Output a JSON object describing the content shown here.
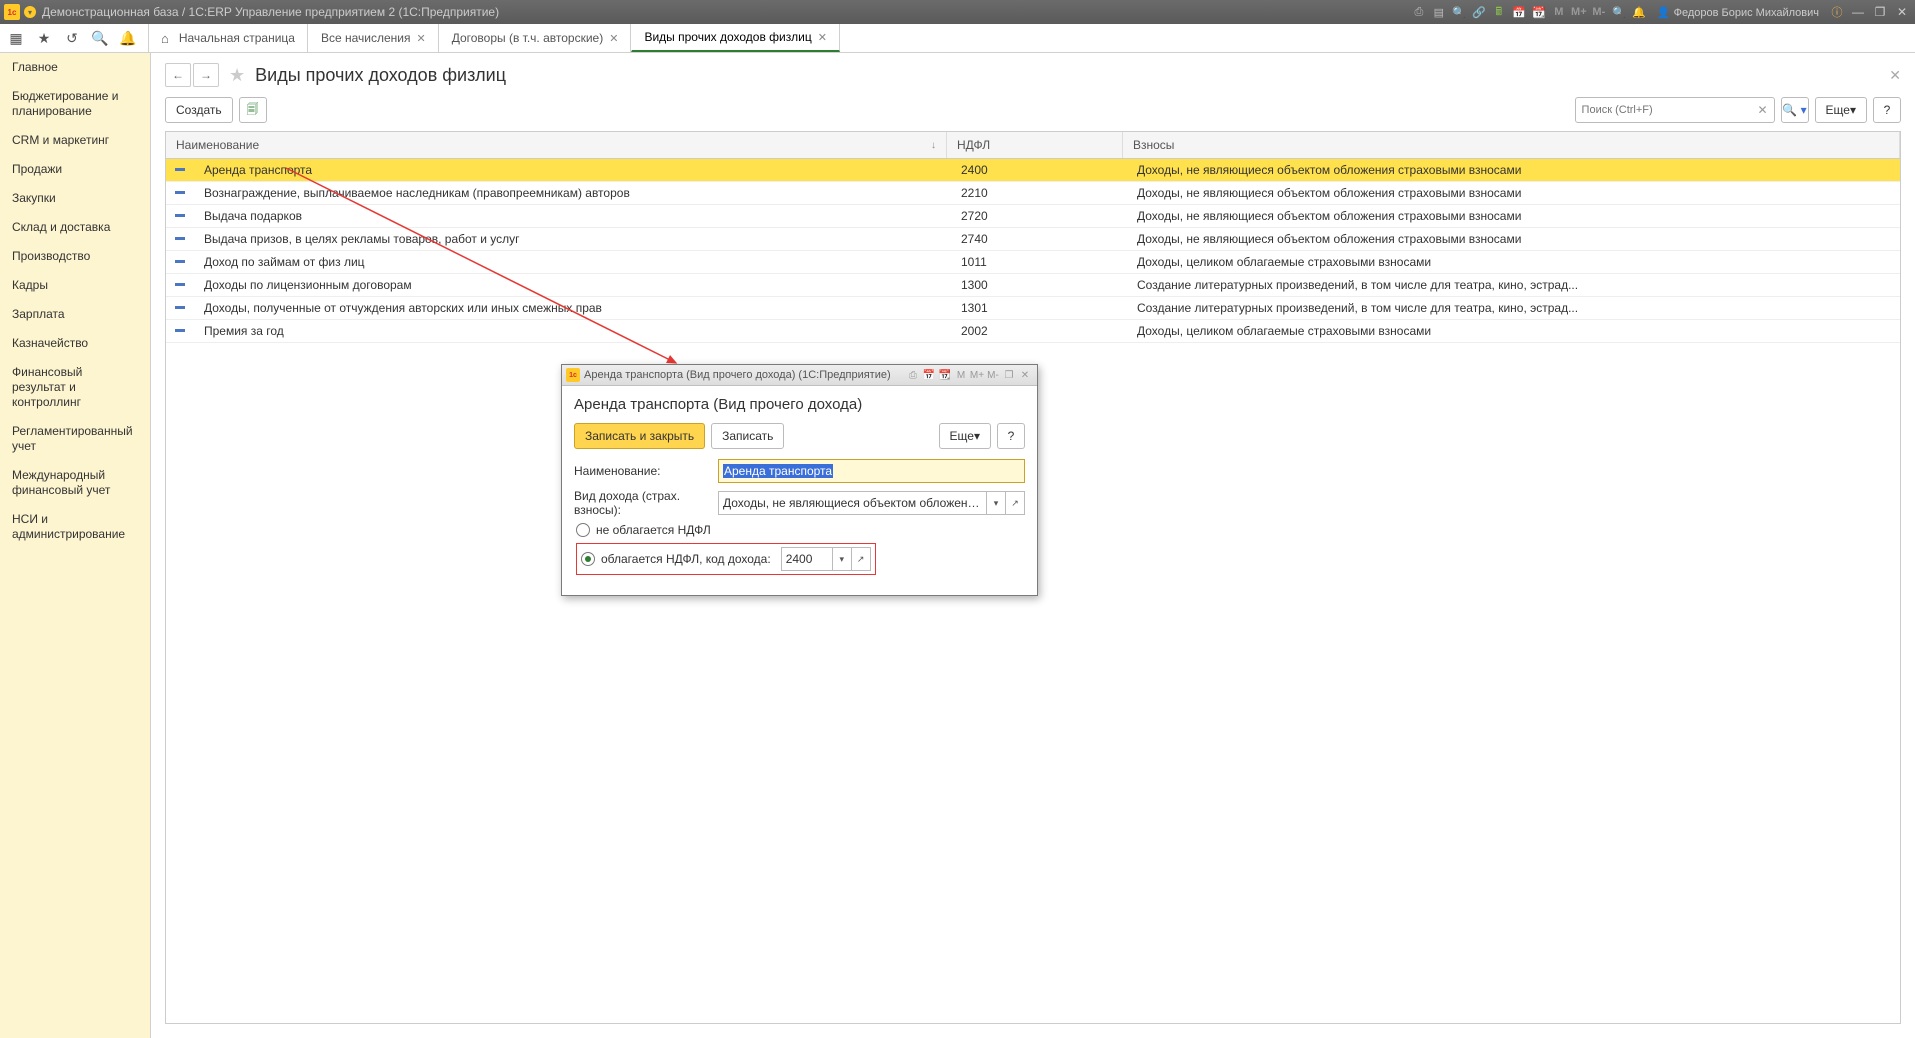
{
  "app": {
    "title": "Демонстрационная база / 1С:ERP Управление предприятием 2  (1С:Предприятие)",
    "user": "Федоров Борис Михайлович",
    "m_buttons": [
      "M",
      "M+",
      "M-"
    ]
  },
  "nav_tabs": {
    "home": "Начальная страница",
    "tabs": [
      {
        "label": "Все начисления"
      },
      {
        "label": "Договоры (в т.ч. авторские)"
      },
      {
        "label": "Виды прочих доходов физлиц",
        "active": true
      }
    ]
  },
  "sidebar": {
    "items": [
      "Главное",
      "Бюджетирование и планирование",
      "CRM и маркетинг",
      "Продажи",
      "Закупки",
      "Склад и доставка",
      "Производство",
      "Кадры",
      "Зарплата",
      "Казначейство",
      "Финансовый результат и контроллинг",
      "Регламентированный учет",
      "Международный финансовый учет",
      "НСИ и администрирование"
    ]
  },
  "page": {
    "title": "Виды прочих доходов физлиц",
    "create_label": "Создать",
    "search_placeholder": "Поиск (Ctrl+F)",
    "more_label": "Еще",
    "help_label": "?"
  },
  "table": {
    "columns": {
      "name": "Наименование",
      "ndfl": "НДФЛ",
      "vzn": "Взносы"
    },
    "rows": [
      {
        "name": "Аренда транспорта",
        "ndfl": "2400",
        "vzn": "Доходы, не являющиеся объектом обложения страховыми взносами",
        "selected": true
      },
      {
        "name": "Вознаграждение, выплачиваемое наследникам (правопреемникам) авторов",
        "ndfl": "2210",
        "vzn": "Доходы, не являющиеся объектом обложения страховыми взносами"
      },
      {
        "name": "Выдача подарков",
        "ndfl": "2720",
        "vzn": "Доходы, не являющиеся объектом обложения страховыми взносами"
      },
      {
        "name": "Выдача призов, в целях рекламы товаров, работ и услуг",
        "ndfl": "2740",
        "vzn": "Доходы, не являющиеся объектом обложения страховыми взносами"
      },
      {
        "name": "Доход по займам от физ лиц",
        "ndfl": "1011",
        "vzn": "Доходы, целиком облагаемые страховыми взносами"
      },
      {
        "name": "Доходы по лицензионным договорам",
        "ndfl": "1300",
        "vzn": "Создание литературных произведений, в том числе для театра, кино, эстрад..."
      },
      {
        "name": "Доходы, полученные от отчуждения авторских или иных смежных прав",
        "ndfl": "1301",
        "vzn": "Создание литературных произведений, в том числе для театра, кино, эстрад..."
      },
      {
        "name": "Премия за год",
        "ndfl": "2002",
        "vzn": "Доходы, целиком облагаемые страховыми взносами"
      }
    ]
  },
  "dialog": {
    "window_title": "Аренда транспорта (Вид прочего дохода)  (1С:Предприятие)",
    "heading": "Аренда транспорта (Вид прочего дохода)",
    "save_close": "Записать и закрыть",
    "save": "Записать",
    "more": "Еще",
    "help": "?",
    "m_buttons": [
      "M",
      "M+",
      "M-"
    ],
    "fields": {
      "name_label": "Наименование:",
      "name_value": "Аренда транспорта",
      "kind_label": "Вид дохода (страх. взносы):",
      "kind_value": "Доходы, не являющиеся объектом обложения страховым",
      "radio_no_tax": "не облагается НДФЛ",
      "radio_tax": "облагается НДФЛ, код дохода:",
      "code_value": "2400"
    }
  }
}
